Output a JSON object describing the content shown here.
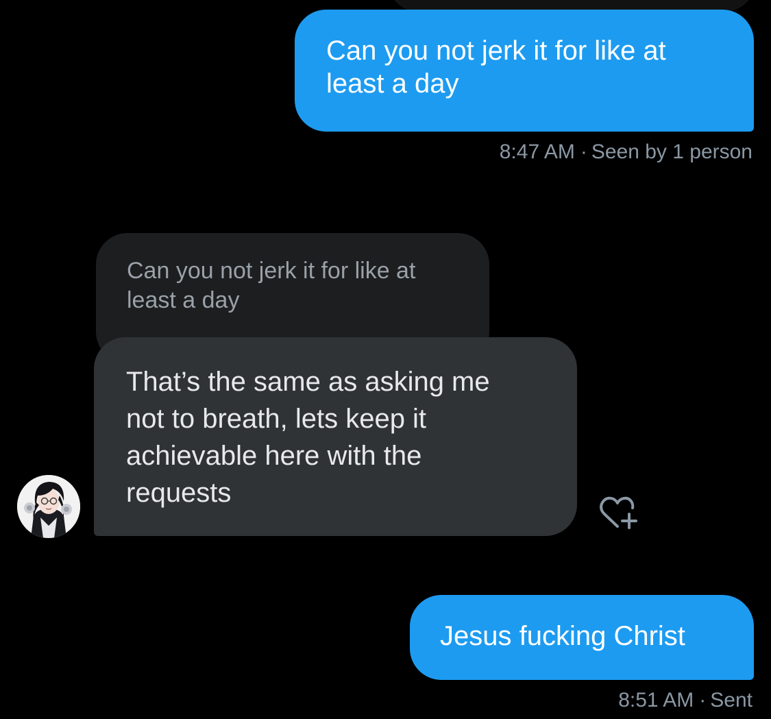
{
  "conversation": {
    "messages": [
      {
        "direction": "outgoing",
        "text_line1": "Can you not jerk it for like at",
        "text_line2": "least a day",
        "time": "8:47 AM",
        "separator": "·",
        "status": "Seen by 1 person"
      },
      {
        "direction": "incoming",
        "reply_to": {
          "line1": "Can you not jerk it for like at",
          "line2": "least a day"
        },
        "lines": [
          "That’s the same as asking me",
          "not to breath, lets keep it",
          "achievable here with the",
          "requests"
        ],
        "avatar_icon": "anime-character-avatar-icon",
        "reaction_icon": "heart-plus-icon"
      },
      {
        "direction": "outgoing",
        "text": "Jesus fucking Christ",
        "time": "8:51 AM",
        "separator": "·",
        "status": "Sent"
      }
    ]
  },
  "colors": {
    "background": "#000000",
    "outgoing_bubble": "#1d9bf0",
    "incoming_bubble": "#2f3336",
    "quoted_bubble": "#1c1e20",
    "meta_text": "#8b98a5"
  }
}
